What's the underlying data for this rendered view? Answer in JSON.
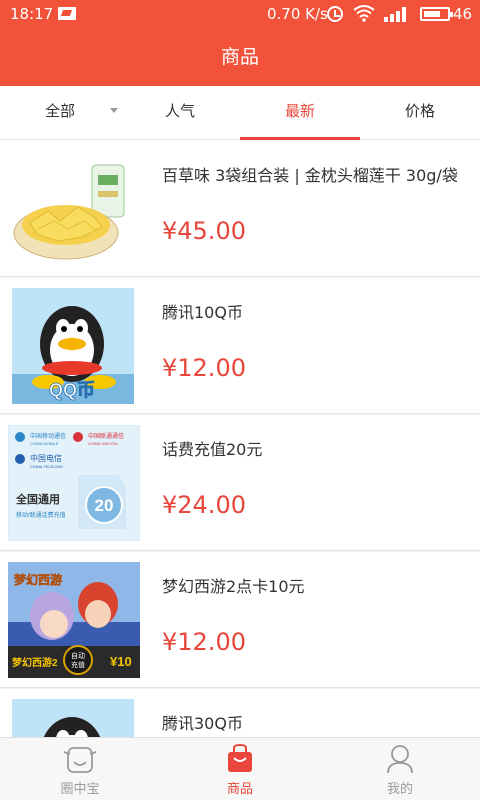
{
  "status_bar": {
    "time": "18:17",
    "net_speed": "0.70 K/s",
    "battery": "46"
  },
  "header": {
    "title": "商品"
  },
  "tabs": [
    {
      "label": "全部"
    },
    {
      "label": "人气"
    },
    {
      "label": "最新"
    },
    {
      "label": "价格"
    }
  ],
  "products": [
    {
      "title": "百草味 3袋组合装 | 金枕头榴莲干 30g/袋",
      "price": "¥45.00"
    },
    {
      "title": "腾讯10Q币",
      "price": "¥12.00"
    },
    {
      "title": "话费充值20元",
      "price": "¥24.00"
    },
    {
      "title": "梦幻西游2点卡10元",
      "price": "¥12.00"
    },
    {
      "title": "腾讯30Q币",
      "price": ""
    }
  ],
  "thumb_text": {
    "qq_label": "QQ币",
    "china_mobile": "中国移动通信",
    "china_mobile_en": "CHINA MOBILE",
    "china_unicom": "中国联通通信",
    "china_unicom_en": "CHINA UNICOM",
    "china_telecom": "中国电信",
    "china_telecom_en": "CHINA TELECOM",
    "nationwide": "全国通用",
    "card_value": "20",
    "card_sub": "移动/联通话费充值",
    "game_name": "梦幻西游2",
    "auto_charge_1": "自动",
    "auto_charge_2": "充值",
    "game_value": "¥10"
  },
  "bottom_nav": [
    {
      "label": "圈中宝",
      "icon": "smile-face-icon"
    },
    {
      "label": "商品",
      "icon": "shopping-bag-icon"
    },
    {
      "label": "我的",
      "icon": "user-icon"
    }
  ],
  "colors": {
    "brand": "#f2513a",
    "price": "#e8463a",
    "active": "#e8463a",
    "inactive": "#9a9a9a"
  }
}
